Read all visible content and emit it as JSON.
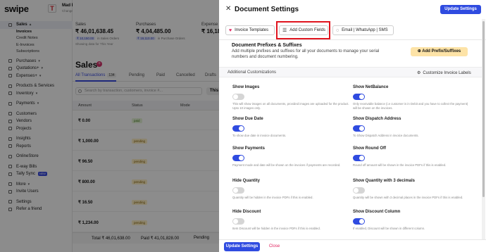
{
  "app": {
    "logo": "swipe",
    "logo_badge": "T",
    "company_name": "Mad Enterprises and CO",
    "company_sub": "Change Company"
  },
  "sidebar": {
    "sales": "Sales",
    "sales_items": [
      "Invoices",
      "Credit Notes",
      "E-Invoices",
      "Subscriptions"
    ],
    "purchases": "Purchases",
    "quotations": "Quotations+",
    "expenses": "Expenses+",
    "products": "Products & Services",
    "inventory": "Inventory",
    "payments": "Payments",
    "customers": "Customers",
    "vendors": "Vendors",
    "projects": "Projects",
    "insights": "Insights",
    "reports": "Reports",
    "onlinestore": "OnlineStore",
    "ewaybills": "E-way Bills",
    "tallysync": "Tally Sync",
    "new_badge": "NEW",
    "more": "More",
    "invite": "Invite Users",
    "settings": "Settings",
    "refer": "Refer a friend"
  },
  "stats": {
    "sales_label": "Sales",
    "sales_value": "₹ 46,01,638.45",
    "sales_sub_chip": "₹ 10,150.00",
    "sales_sub_text": "in Sales Orders",
    "sales_note": "Showing data for This Year",
    "purchases_label": "Purchases",
    "purchases_value": "₹ 4,04,485.00",
    "purchases_sub_chip": "₹ 19,110.00",
    "purchases_sub_text": "in Purchase Orders",
    "expenses_label": "Expense",
    "expenses_value": "₹ 16,18"
  },
  "sales_page": {
    "title": "Sales",
    "tabs": [
      "All Transactions",
      "Pending",
      "Paid",
      "Cancelled",
      "Drafts"
    ],
    "all_count": "134",
    "search_placeholder": "Search by transaction, customers, invoice #...",
    "this_btn": "This",
    "columns": [
      "Amount",
      "Status",
      "Mode"
    ],
    "rows": [
      {
        "amount": "₹ 0.00",
        "status": "paid"
      },
      {
        "amount": "₹ 1,000.00",
        "status": "pending"
      },
      {
        "amount": "₹ 96.50",
        "status": "pending"
      },
      {
        "amount": "₹ 800.00",
        "status": "pending"
      },
      {
        "amount": "₹ 16.50",
        "status": "pending"
      },
      {
        "amount": "₹ 1,234.00",
        "status": "pending"
      }
    ],
    "footer_total": "Total ₹ 46,01,638.00",
    "footer_paid": "Paid ₹ 41,01,828.00",
    "footer_pending": "Pending"
  },
  "drawer": {
    "title": "Document Settings",
    "update_label": "Update Settings",
    "close_label": "Close",
    "segments": [
      "Invoice Templates",
      "Add Custom Fields",
      "Email | WhatsApp | SMS"
    ],
    "prefix_title": "Document Prefixes & Suffixes",
    "prefix_desc": "Add multiple prefixes and suffixes for all your documents to manage your serial numbers and document numbering.",
    "add_prefix_label": "Add Prefix/Suffixes",
    "additional_title": "Additional Customizations",
    "customize_labels": "Customize Invoice Labels",
    "options_left": [
      {
        "title": "Show Images",
        "on": false,
        "desc": "This will show images on all documents, provided images are uploaded for the product. Upto 10 images only."
      },
      {
        "title": "Show Due Date",
        "on": true,
        "desc": "To show due date in invoice documents."
      },
      {
        "title": "Show Payments",
        "on": true,
        "desc": "Payment mode and date will be shown on the invoices if payments are recorded."
      },
      {
        "title": "Hide Quantity",
        "on": false,
        "desc": "Quantity will be hidden in the invoice PDFs if this is enabled."
      },
      {
        "title": "Hide Discount",
        "on": false,
        "desc": "Item Discount will be hidden in the invoice PDFs if this is enabled."
      }
    ],
    "options_right": [
      {
        "title": "Show NetBalance",
        "on": true,
        "desc": "Only receivable balance (i.e customer is in Debit and you have to collect the payment) will be shown on the invoices."
      },
      {
        "title": "Show Dispatch Address",
        "on": true,
        "desc": "To Show Dispatch Address in invoice documents."
      },
      {
        "title": "Show Round Off",
        "on": true,
        "desc": "Round off amount will be shown in the invoice PDFs if this is enabled."
      },
      {
        "title": "Show Quantity with 3 decimals",
        "on": false,
        "desc": "Quantity will be shown with 3 decimal places in the invoice PDFs if this is enabled."
      },
      {
        "title": "Show Discount Column",
        "on": true,
        "desc": "If enabled, Discount will be shown in different column."
      }
    ]
  },
  "colors": {
    "primary": "#2f4be0",
    "highlight": "#e0141e",
    "accent_yellow": "#fde3a7",
    "close_red": "#e0245e"
  }
}
